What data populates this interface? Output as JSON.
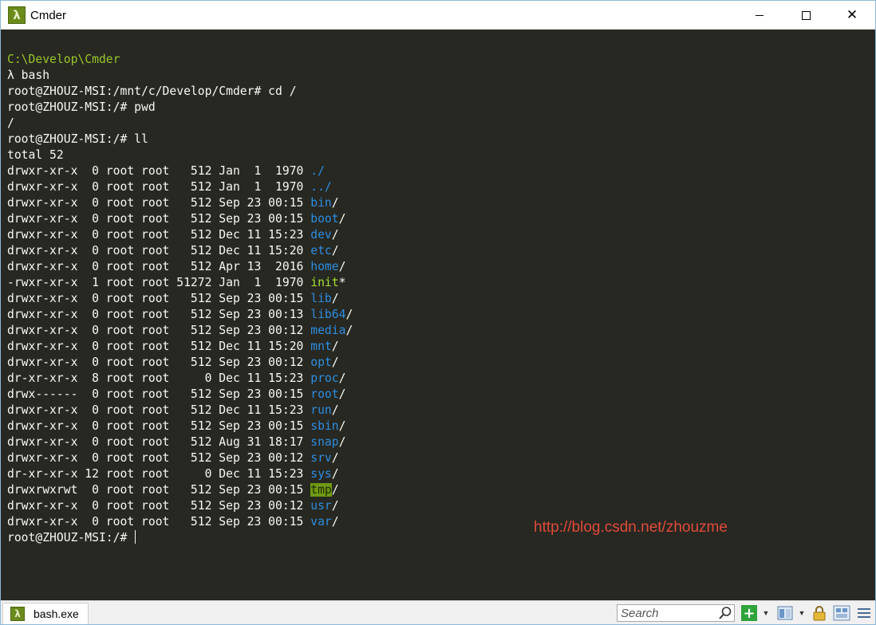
{
  "window": {
    "title": "Cmder",
    "icon": "lambda-icon"
  },
  "terminal": {
    "lines": [
      [
        {
          "t": "C:\\Develop\\Cmder",
          "c": "c-green"
        }
      ],
      [
        {
          "t": "λ bash"
        }
      ],
      [
        {
          "t": "root@ZHOUZ-MSI:/mnt/c/Develop/Cmder# cd /"
        }
      ],
      [
        {
          "t": "root@ZHOUZ-MSI:/# pwd"
        }
      ],
      [
        {
          "t": "/"
        }
      ],
      [
        {
          "t": "root@ZHOUZ-MSI:/# ll"
        }
      ],
      [
        {
          "t": "total 52"
        }
      ],
      [
        {
          "t": "drwxr-xr-x  0 root root   512 Jan  1  1970 "
        },
        {
          "t": "./",
          "c": "c-blue"
        }
      ],
      [
        {
          "t": "drwxr-xr-x  0 root root   512 Jan  1  1970 "
        },
        {
          "t": "../",
          "c": "c-blue"
        }
      ],
      [
        {
          "t": "drwxr-xr-x  0 root root   512 Sep 23 00:15 "
        },
        {
          "t": "bin",
          "c": "c-blue"
        },
        {
          "t": "/"
        }
      ],
      [
        {
          "t": "drwxr-xr-x  0 root root   512 Sep 23 00:15 "
        },
        {
          "t": "boot",
          "c": "c-blue"
        },
        {
          "t": "/"
        }
      ],
      [
        {
          "t": "drwxr-xr-x  0 root root   512 Dec 11 15:23 "
        },
        {
          "t": "dev",
          "c": "c-blue"
        },
        {
          "t": "/"
        }
      ],
      [
        {
          "t": "drwxr-xr-x  0 root root   512 Dec 11 15:20 "
        },
        {
          "t": "etc",
          "c": "c-blue"
        },
        {
          "t": "/"
        }
      ],
      [
        {
          "t": "drwxr-xr-x  0 root root   512 Apr 13  2016 "
        },
        {
          "t": "home",
          "c": "c-blue"
        },
        {
          "t": "/"
        }
      ],
      [
        {
          "t": "-rwxr-xr-x  1 root root 51272 Jan  1  1970 "
        },
        {
          "t": "init",
          "c": "c-exec"
        },
        {
          "t": "*"
        }
      ],
      [
        {
          "t": "drwxr-xr-x  0 root root   512 Sep 23 00:15 "
        },
        {
          "t": "lib",
          "c": "c-blue"
        },
        {
          "t": "/"
        }
      ],
      [
        {
          "t": "drwxr-xr-x  0 root root   512 Sep 23 00:13 "
        },
        {
          "t": "lib64",
          "c": "c-blue"
        },
        {
          "t": "/"
        }
      ],
      [
        {
          "t": "drwxr-xr-x  0 root root   512 Sep 23 00:12 "
        },
        {
          "t": "media",
          "c": "c-blue"
        },
        {
          "t": "/"
        }
      ],
      [
        {
          "t": "drwxr-xr-x  0 root root   512 Dec 11 15:20 "
        },
        {
          "t": "mnt",
          "c": "c-blue"
        },
        {
          "t": "/"
        }
      ],
      [
        {
          "t": "drwxr-xr-x  0 root root   512 Sep 23 00:12 "
        },
        {
          "t": "opt",
          "c": "c-blue"
        },
        {
          "t": "/"
        }
      ],
      [
        {
          "t": "dr-xr-xr-x  8 root root     0 Dec 11 15:23 "
        },
        {
          "t": "proc",
          "c": "c-blue"
        },
        {
          "t": "/"
        }
      ],
      [
        {
          "t": "drwx------  0 root root   512 Sep 23 00:15 "
        },
        {
          "t": "root",
          "c": "c-blue"
        },
        {
          "t": "/"
        }
      ],
      [
        {
          "t": "drwxr-xr-x  0 root root   512 Dec 11 15:23 "
        },
        {
          "t": "run",
          "c": "c-blue"
        },
        {
          "t": "/"
        }
      ],
      [
        {
          "t": "drwxr-xr-x  0 root root   512 Sep 23 00:15 "
        },
        {
          "t": "sbin",
          "c": "c-blue"
        },
        {
          "t": "/"
        }
      ],
      [
        {
          "t": "drwxr-xr-x  0 root root   512 Aug 31 18:17 "
        },
        {
          "t": "snap",
          "c": "c-blue"
        },
        {
          "t": "/"
        }
      ],
      [
        {
          "t": "drwxr-xr-x  0 root root   512 Sep 23 00:12 "
        },
        {
          "t": "srv",
          "c": "c-blue"
        },
        {
          "t": "/"
        }
      ],
      [
        {
          "t": "dr-xr-xr-x 12 root root     0 Dec 11 15:23 "
        },
        {
          "t": "sys",
          "c": "c-blue"
        },
        {
          "t": "/"
        }
      ],
      [
        {
          "t": "drwxrwxrwt  0 root root   512 Sep 23 00:15 "
        },
        {
          "t": "tmp",
          "c": "c-hl"
        },
        {
          "t": "/"
        }
      ],
      [
        {
          "t": "drwxr-xr-x  0 root root   512 Sep 23 00:12 "
        },
        {
          "t": "usr",
          "c": "c-blue"
        },
        {
          "t": "/"
        }
      ],
      [
        {
          "t": "drwxr-xr-x  0 root root   512 Sep 23 00:15 "
        },
        {
          "t": "var",
          "c": "c-blue"
        },
        {
          "t": "/"
        }
      ],
      [
        {
          "t": "root@ZHOUZ-MSI:/# "
        }
      ]
    ],
    "watermark": "http://blog.csdn.net/zhouzme",
    "colors": {
      "background": "#272822",
      "text": "#f8f8f2",
      "path": "#98c62a",
      "directory": "#2d8de0",
      "executable": "#a6e22e",
      "highlight": "#6f9a12"
    }
  },
  "statusbar": {
    "tab_label": "bash.exe",
    "search_placeholder": "Search",
    "icons": [
      "search-icon",
      "add-console-icon",
      "split-icon",
      "lock-icon",
      "window-mode-icon",
      "menu-icon"
    ]
  }
}
